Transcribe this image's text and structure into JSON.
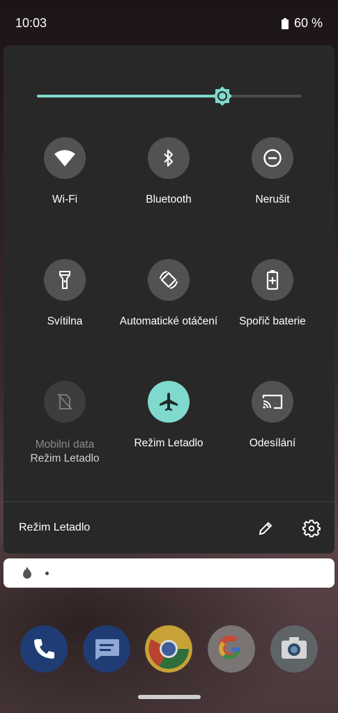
{
  "status_bar": {
    "time": "10:03",
    "battery_text": "60 %"
  },
  "quick_settings": {
    "brightness_level": 0.7,
    "accent_color": "#7fd9cc",
    "tiles": [
      {
        "label": "Wi-Fi",
        "icon": "wifi-icon",
        "state": "inactive"
      },
      {
        "label": "Bluetooth",
        "icon": "bluetooth-icon",
        "state": "inactive"
      },
      {
        "label": "Nerušit",
        "icon": "do-not-disturb-icon",
        "state": "inactive"
      },
      {
        "label": "Svítilna",
        "icon": "flashlight-icon",
        "state": "inactive"
      },
      {
        "label": "Automatické otáčení",
        "icon": "auto-rotate-icon",
        "state": "inactive"
      },
      {
        "label": "Spořič baterie",
        "icon": "battery-saver-icon",
        "state": "inactive"
      },
      {
        "label": "Mobilní data",
        "sublabel": "Režim Letadlo",
        "icon": "mobile-data-off-icon",
        "state": "disabled"
      },
      {
        "label": "Režim Letadlo",
        "icon": "airplane-icon",
        "state": "active"
      },
      {
        "label": "Odesílání",
        "icon": "cast-icon",
        "state": "inactive"
      }
    ],
    "footer_label": "Režim Letadlo"
  },
  "dock": {
    "apps": [
      "phone-icon",
      "messages-icon",
      "chrome-icon",
      "google-icon",
      "camera-icon"
    ]
  }
}
